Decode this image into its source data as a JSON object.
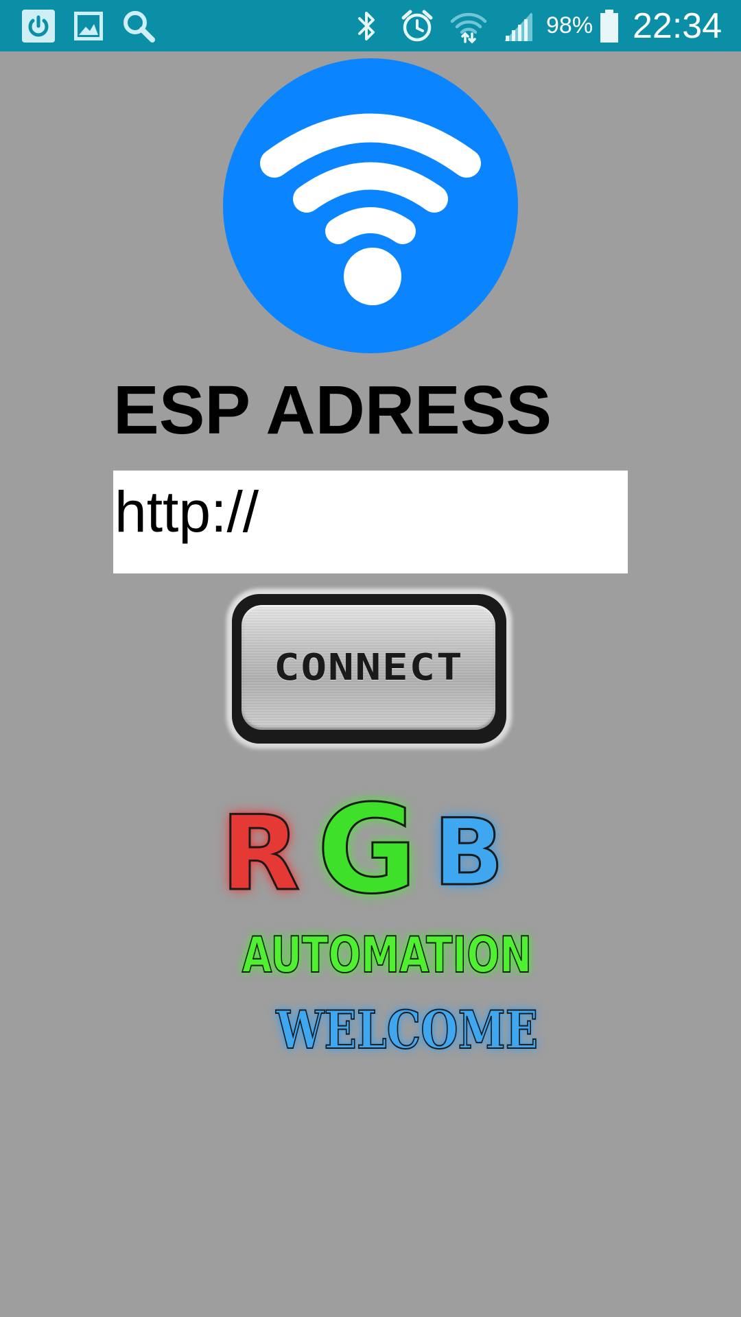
{
  "status_bar": {
    "background_color": "#0b8fa6",
    "left_icons": [
      "power-icon",
      "gallery-icon",
      "search-icon"
    ],
    "right_icons": [
      "bluetooth-icon",
      "alarm-icon",
      "wifi-signal-icon",
      "cell-signal-icon",
      "battery-icon"
    ],
    "battery_percent": "98%",
    "time": "22:34"
  },
  "main": {
    "logo_icon": "wifi-icon",
    "logo_color": "#0a84ff",
    "address_label": "ESP ADRESS",
    "address_input": {
      "value": "http://",
      "placeholder": ""
    },
    "connect_button_label": "CONNECT",
    "brand": {
      "letters": [
        "R",
        "G",
        "B"
      ],
      "letter_colors": [
        "#e53935",
        "#3fe02a",
        "#3fa6f0"
      ],
      "subtitle": "AUTOMATION",
      "tagline": "WELCOME"
    }
  }
}
